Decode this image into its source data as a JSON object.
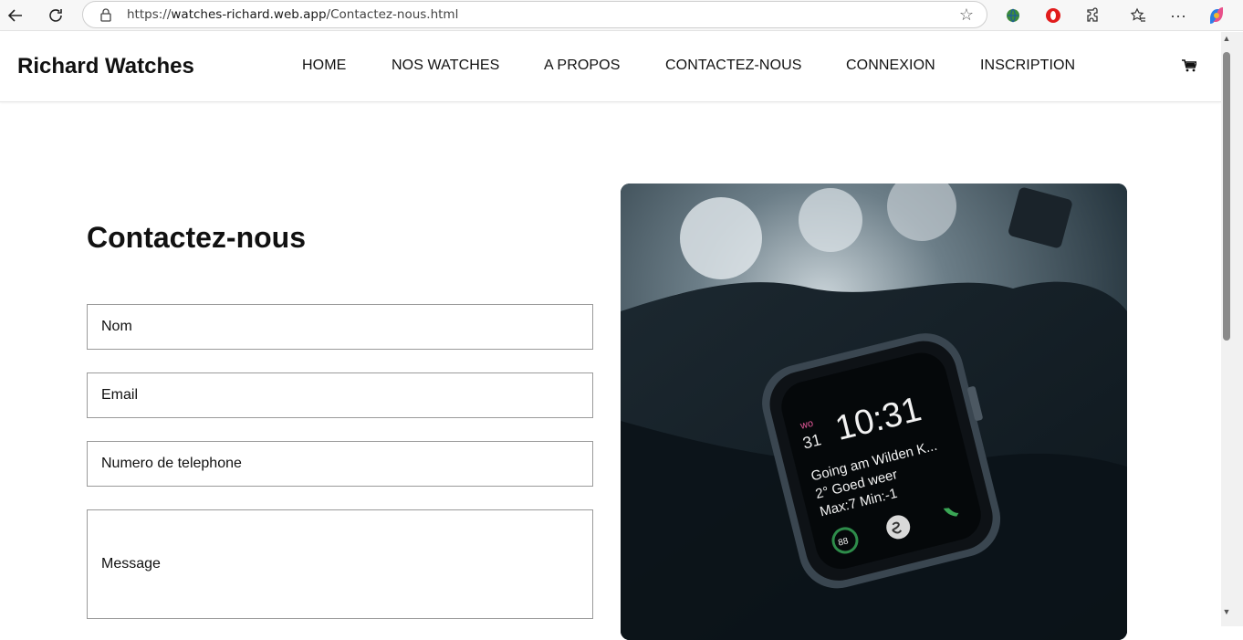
{
  "browser": {
    "url_prefix": "https://",
    "url_host": "watches-richard.web.app",
    "url_path": "/Contactez-nous.html"
  },
  "site": {
    "brand": "Richard Watches",
    "nav": [
      "HOME",
      "NOS WATCHES",
      "A PROPOS",
      "CONTACTEZ-NOUS",
      "CONNEXION",
      "INSCRIPTION"
    ]
  },
  "contact": {
    "title": "Contactez-nous",
    "name_placeholder": "Nom",
    "email_placeholder": "Email",
    "phone_placeholder": "Numero de telephone",
    "message_placeholder": "Message"
  },
  "watch": {
    "day_label": "wo",
    "day_num": "31",
    "time": "10:31",
    "line1": "Going am Wilden K...",
    "line2": "2° Goed weer",
    "line3": "Max:7 Min:-1",
    "ring_value": "88"
  }
}
